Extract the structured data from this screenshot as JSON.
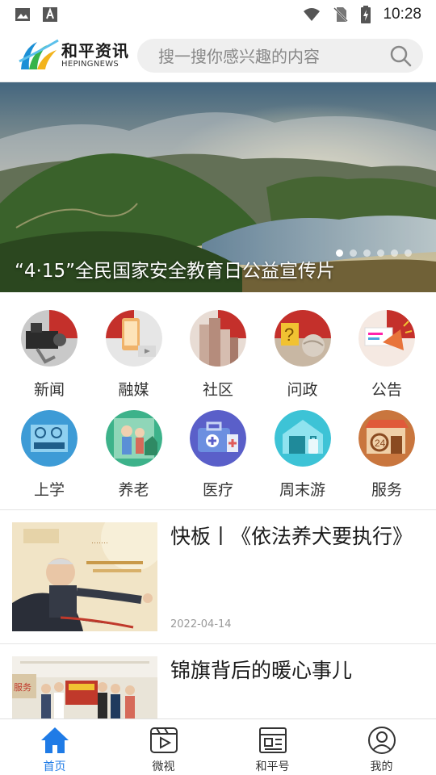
{
  "status_bar": {
    "time": "10:28"
  },
  "header": {
    "logo_cn": "和平资讯",
    "logo_en": "HEPINGNEWS",
    "search_placeholder": "搜一搜你感兴趣的内容"
  },
  "banner": {
    "caption": "“4·15”全民国家安全教育日公益宣传片",
    "slide_count": 6,
    "active_slide": 1
  },
  "categories": [
    {
      "label": "新闻",
      "icon": "news-camera-icon"
    },
    {
      "label": "融媒",
      "icon": "phone-media-icon"
    },
    {
      "label": "社区",
      "icon": "buildings-icon"
    },
    {
      "label": "问政",
      "icon": "question-icon"
    },
    {
      "label": "公告",
      "icon": "megaphone-icon"
    },
    {
      "label": "上学",
      "icon": "school-icon"
    },
    {
      "label": "养老",
      "icon": "elderly-icon"
    },
    {
      "label": "医疗",
      "icon": "medical-kit-icon"
    },
    {
      "label": "周末游",
      "icon": "travel-icon"
    },
    {
      "label": "服务",
      "icon": "service-24-icon"
    }
  ],
  "news": [
    {
      "title": "快板丨《依法养犬要执行》",
      "date": "2022-04-14"
    },
    {
      "title": "锦旗背后的暖心事儿",
      "date": ""
    }
  ],
  "tabs": [
    {
      "label": "首页",
      "icon": "home-icon",
      "active": true
    },
    {
      "label": "微视",
      "icon": "video-icon",
      "active": false
    },
    {
      "label": "和平号",
      "icon": "account-icon",
      "active": false
    },
    {
      "label": "我的",
      "icon": "user-icon",
      "active": false
    }
  ],
  "colors": {
    "accent": "#1f7be6"
  }
}
